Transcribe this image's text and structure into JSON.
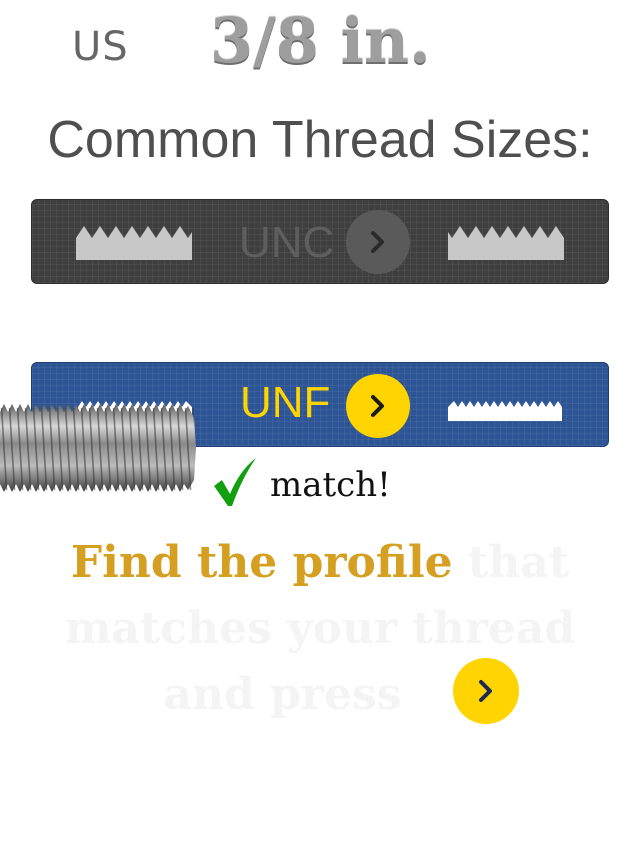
{
  "header": {
    "unit_system": "US",
    "bolt_size": "3/8 in."
  },
  "heading": "Common Thread Sizes:",
  "options": {
    "coarse": {
      "label": "UNC"
    },
    "fine": {
      "label": "UNF"
    }
  },
  "match_label": "match!",
  "instruction": {
    "highlight": "Find the profile",
    "line1_rest": "that",
    "line2": "matches your thread",
    "line3": "and press"
  },
  "colors": {
    "accent_yellow": "#ffd400",
    "selected_bar": "#2d5494",
    "unselected_bar": "#3f3f3f",
    "instruction_highlight": "#d59f22",
    "check_green": "#12a012"
  },
  "icons": {
    "arrow": "chevron-right-icon",
    "match": "check-mark-icon",
    "profile": "thread-profile-icon"
  }
}
